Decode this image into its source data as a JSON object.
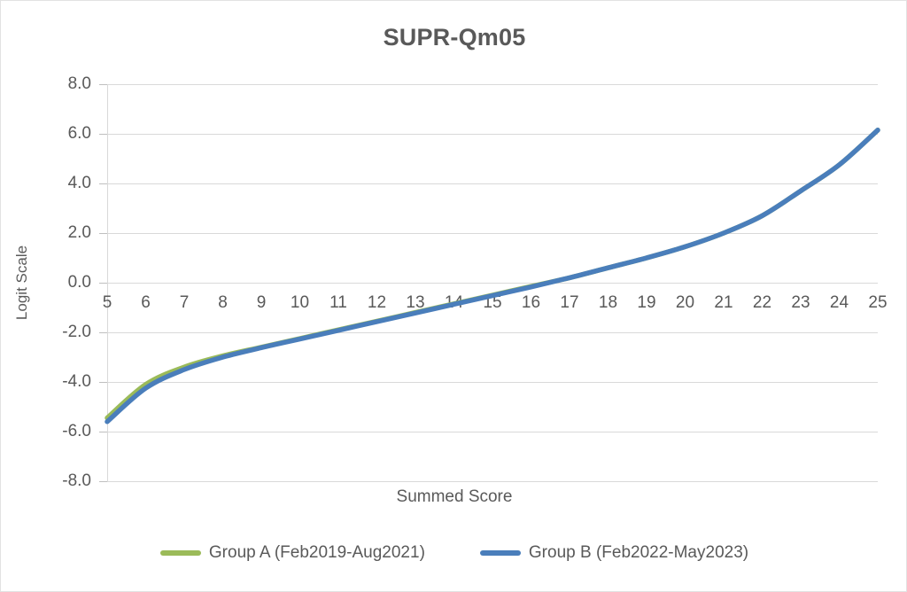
{
  "chart_data": {
    "type": "line",
    "title": "SUPR-Qm05",
    "xlabel": "Summed Score",
    "ylabel": "Logit Scale",
    "xlim": [
      5,
      25
    ],
    "ylim": [
      -8.0,
      8.0
    ],
    "grid": true,
    "legend_position": "bottom",
    "x": [
      5,
      6,
      7,
      8,
      9,
      10,
      11,
      12,
      13,
      14,
      15,
      16,
      17,
      18,
      19,
      20,
      21,
      22,
      23,
      24,
      25
    ],
    "xticklabels": [
      "5",
      "6",
      "7",
      "8",
      "9",
      "10",
      "11",
      "12",
      "13",
      "14",
      "15",
      "16",
      "17",
      "18",
      "19",
      "20",
      "21",
      "22",
      "23",
      "24",
      "25"
    ],
    "yticklabels": [
      "8.0",
      "6.0",
      "4.0",
      "2.0",
      "0.0",
      "-2.0",
      "-4.0",
      "-6.0",
      "-8.0"
    ],
    "yticks": [
      8.0,
      6.0,
      4.0,
      2.0,
      0.0,
      -2.0,
      -4.0,
      -6.0,
      -8.0
    ],
    "series": [
      {
        "name": "Group A (Feb2019-Aug2021)",
        "color": "#9BBB59",
        "values": [
          -5.45,
          -4.1,
          -3.4,
          -2.95,
          -2.6,
          -2.25,
          -1.9,
          -1.55,
          -1.2,
          -0.85,
          -0.5,
          -0.15,
          0.2,
          0.6,
          1.0,
          1.45,
          2.0,
          2.7,
          3.7,
          4.75,
          6.15
        ]
      },
      {
        "name": "Group B (Feb2022-May2023)",
        "color": "#4A7EBB",
        "values": [
          -5.6,
          -4.25,
          -3.5,
          -3.0,
          -2.62,
          -2.27,
          -1.92,
          -1.57,
          -1.22,
          -0.87,
          -0.52,
          -0.17,
          0.2,
          0.6,
          1.0,
          1.45,
          2.0,
          2.7,
          3.7,
          4.75,
          6.15
        ]
      }
    ]
  },
  "legend": [
    {
      "label": "Group A (Feb2019-Aug2021)",
      "color": "#9BBB59"
    },
    {
      "label": "Group B (Feb2022-May2023)",
      "color": "#4A7EBB"
    }
  ]
}
